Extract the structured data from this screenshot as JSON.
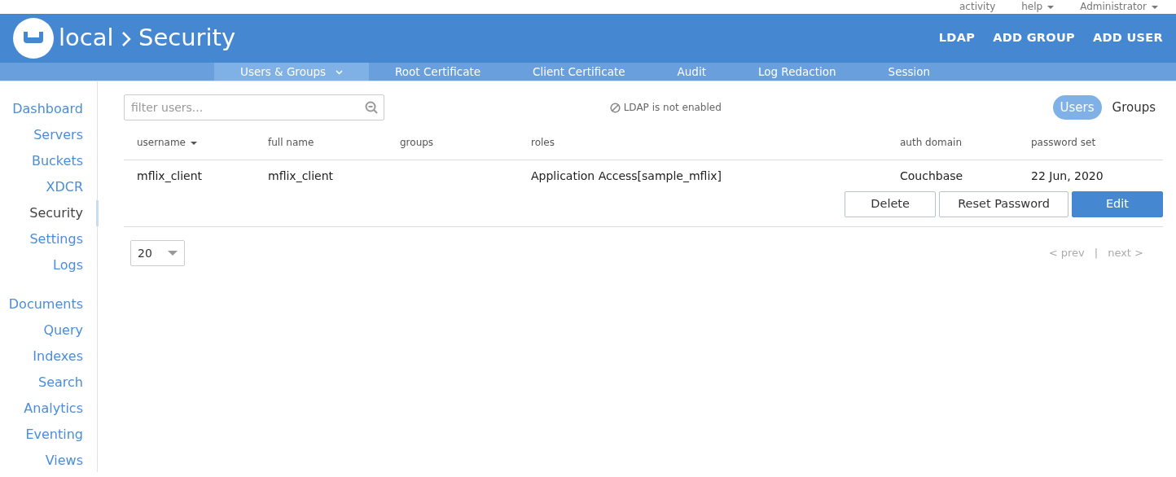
{
  "top_links": [
    {
      "label": "activity",
      "has_menu": false
    },
    {
      "label": "help",
      "has_menu": true
    },
    {
      "label": "Administrator",
      "has_menu": true
    }
  ],
  "header": {
    "parent": "local",
    "current": "Security",
    "actions": [
      "LDAP",
      "ADD GROUP",
      "ADD USER"
    ]
  },
  "subnav": [
    {
      "label": "Users & Groups",
      "selected": true,
      "has_menu": true
    },
    {
      "label": "Root Certificate",
      "selected": false,
      "has_menu": false
    },
    {
      "label": "Client Certificate",
      "selected": false,
      "has_menu": false
    },
    {
      "label": "Audit",
      "selected": false,
      "has_menu": false
    },
    {
      "label": "Log Redaction",
      "selected": false,
      "has_menu": false
    },
    {
      "label": "Session",
      "selected": false,
      "has_menu": false
    }
  ],
  "sidebar": {
    "groups": [
      [
        {
          "label": "Dashboard",
          "selected": false
        },
        {
          "label": "Servers",
          "selected": false
        },
        {
          "label": "Buckets",
          "selected": false
        },
        {
          "label": "XDCR",
          "selected": false
        },
        {
          "label": "Security",
          "selected": true
        },
        {
          "label": "Settings",
          "selected": false
        },
        {
          "label": "Logs",
          "selected": false
        }
      ],
      [
        {
          "label": "Documents",
          "selected": false
        },
        {
          "label": "Query",
          "selected": false
        },
        {
          "label": "Indexes",
          "selected": false
        },
        {
          "label": "Search",
          "selected": false
        },
        {
          "label": "Analytics",
          "selected": false
        },
        {
          "label": "Eventing",
          "selected": false
        },
        {
          "label": "Views",
          "selected": false
        }
      ]
    ]
  },
  "filter": {
    "placeholder": "filter users..."
  },
  "ldap_notice": "LDAP is not enabled",
  "view_toggle": [
    {
      "label": "Users",
      "selected": true
    },
    {
      "label": "Groups",
      "selected": false
    }
  ],
  "table": {
    "columns": [
      {
        "label": "username",
        "sorted": true
      },
      {
        "label": "full name",
        "sorted": false
      },
      {
        "label": "groups",
        "sorted": false
      },
      {
        "label": "roles",
        "sorted": false
      },
      {
        "label": "auth domain",
        "sorted": false
      },
      {
        "label": "password set",
        "sorted": false
      }
    ],
    "rows": [
      {
        "cells": [
          "mflix_client",
          "mflix_client",
          "",
          "Application Access[sample_mflix]",
          "Couchbase",
          "22 Jun, 2020"
        ],
        "actions": [
          {
            "label": "Delete",
            "kind": "secondary"
          },
          {
            "label": "Reset Password",
            "kind": "secondary"
          },
          {
            "label": "Edit",
            "kind": "primary"
          }
        ]
      }
    ]
  },
  "page_size": "20",
  "pager": {
    "prev": "< prev",
    "separator": "|",
    "next": "next >"
  }
}
